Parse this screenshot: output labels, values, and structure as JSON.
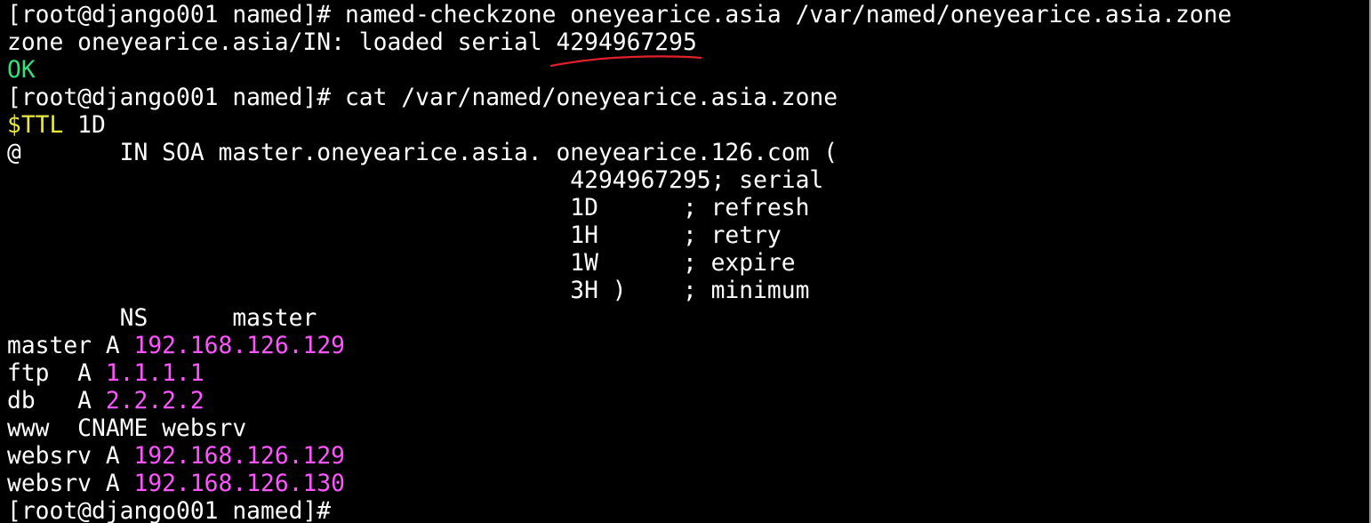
{
  "colors": {
    "background": "#000000",
    "default_text": "#ffffff",
    "ok": "#35e07a",
    "ttl_keyword": "#e8e840",
    "ip_address": "#ff55ff",
    "annotation_underline": "#e0202a",
    "window_border": "#9a9a9a"
  },
  "icons": {
    "annotation": "red-hand-drawn-underline"
  },
  "terminal": {
    "lines": [
      [
        {
          "text": "[root@django001 named]# named-checkzone oneyearice.asia /var/named/oneyearice.asia.zone",
          "color": "default_text"
        }
      ],
      [
        {
          "text": "zone oneyearice.asia/IN: loaded serial 4294967295",
          "color": "default_text"
        }
      ],
      [
        {
          "text": "OK",
          "color": "ok"
        }
      ],
      [
        {
          "text": "[root@django001 named]# cat /var/named/oneyearice.asia.zone",
          "color": "default_text"
        }
      ],
      [
        {
          "text": "$TTL",
          "color": "ttl_keyword"
        },
        {
          "text": " 1D",
          "color": "default_text"
        }
      ],
      [
        {
          "text": "@       IN SOA master.oneyearice.asia. oneyearice.126.com (",
          "color": "default_text"
        }
      ],
      [
        {
          "text": "                                        4294967295; serial",
          "color": "default_text"
        }
      ],
      [
        {
          "text": "                                        1D      ; refresh",
          "color": "default_text"
        }
      ],
      [
        {
          "text": "                                        1H      ; retry",
          "color": "default_text"
        }
      ],
      [
        {
          "text": "                                        1W      ; expire",
          "color": "default_text"
        }
      ],
      [
        {
          "text": "                                        3H )    ; minimum",
          "color": "default_text"
        }
      ],
      [
        {
          "text": "        NS      master",
          "color": "default_text"
        }
      ],
      [
        {
          "text": "master A ",
          "color": "default_text"
        },
        {
          "text": "192.168.126.129",
          "color": "ip_address"
        }
      ],
      [
        {
          "text": "ftp  A ",
          "color": "default_text"
        },
        {
          "text": "1.1.1.1",
          "color": "ip_address"
        }
      ],
      [
        {
          "text": "db   A ",
          "color": "default_text"
        },
        {
          "text": "2.2.2.2",
          "color": "ip_address"
        }
      ],
      [
        {
          "text": "www  CNAME websrv",
          "color": "default_text"
        }
      ],
      [
        {
          "text": "websrv A ",
          "color": "default_text"
        },
        {
          "text": "192.168.126.129",
          "color": "ip_address"
        }
      ],
      [
        {
          "text": "websrv A ",
          "color": "default_text"
        },
        {
          "text": "192.168.126.130",
          "color": "ip_address"
        }
      ],
      [
        {
          "text": "[root@django001 named]# ",
          "color": "default_text"
        }
      ]
    ]
  }
}
